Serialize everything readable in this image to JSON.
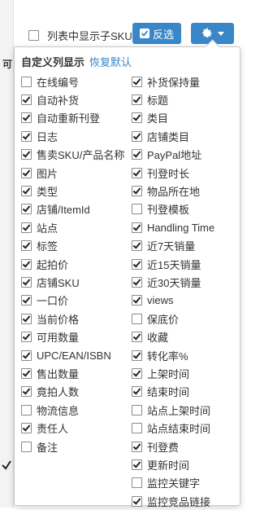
{
  "topbar": {
    "show_sub_sku_label": "列表中显示子SKU",
    "show_sub_sku_checked": false,
    "invert_label": "反选"
  },
  "background": {
    "side_char": "可"
  },
  "panel": {
    "title": "自定义列显示",
    "restore_label": "恢复默认",
    "left_options": [
      {
        "label": "在线编号",
        "checked": false
      },
      {
        "label": "自动补货",
        "checked": true
      },
      {
        "label": "自动重新刊登",
        "checked": true
      },
      {
        "label": "日志",
        "checked": true
      },
      {
        "label": "售卖SKU/产品名称",
        "checked": true
      },
      {
        "label": "图片",
        "checked": true
      },
      {
        "label": "类型",
        "checked": true
      },
      {
        "label": "店铺/ItemId",
        "checked": true
      },
      {
        "label": "站点",
        "checked": true
      },
      {
        "label": "标签",
        "checked": true
      },
      {
        "label": "起拍价",
        "checked": true
      },
      {
        "label": "店铺SKU",
        "checked": true
      },
      {
        "label": "一口价",
        "checked": true
      },
      {
        "label": "当前价格",
        "checked": true
      },
      {
        "label": "可用数量",
        "checked": true
      },
      {
        "label": "UPC/EAN/ISBN",
        "checked": true
      },
      {
        "label": "售出数量",
        "checked": true
      },
      {
        "label": "竟拍人数",
        "checked": true
      },
      {
        "label": "物流信息",
        "checked": false
      },
      {
        "label": "责任人",
        "checked": true
      },
      {
        "label": "备注",
        "checked": false
      }
    ],
    "right_options": [
      {
        "label": "补货保持量",
        "checked": true
      },
      {
        "label": "标题",
        "checked": true
      },
      {
        "label": "类目",
        "checked": true
      },
      {
        "label": "店铺类目",
        "checked": true
      },
      {
        "label": "PayPal地址",
        "checked": true
      },
      {
        "label": "刊登时长",
        "checked": true
      },
      {
        "label": "物品所在地",
        "checked": true
      },
      {
        "label": "刊登模板",
        "checked": false
      },
      {
        "label": "Handling Time",
        "checked": true
      },
      {
        "label": "近7天销量",
        "checked": true
      },
      {
        "label": "近15天销量",
        "checked": true
      },
      {
        "label": "近30天销量",
        "checked": true
      },
      {
        "label": "views",
        "checked": true
      },
      {
        "label": "保底价",
        "checked": false
      },
      {
        "label": "收藏",
        "checked": true
      },
      {
        "label": "转化率%",
        "checked": true
      },
      {
        "label": "上架时间",
        "checked": true
      },
      {
        "label": "结束时间",
        "checked": true
      },
      {
        "label": "站点上架时间",
        "checked": false
      },
      {
        "label": "站点结束时间",
        "checked": false
      },
      {
        "label": "刊登费",
        "checked": true
      },
      {
        "label": "更新时间",
        "checked": true
      },
      {
        "label": "监控关键字",
        "checked": false
      },
      {
        "label": "监控竞品链接",
        "checked": true
      }
    ]
  }
}
